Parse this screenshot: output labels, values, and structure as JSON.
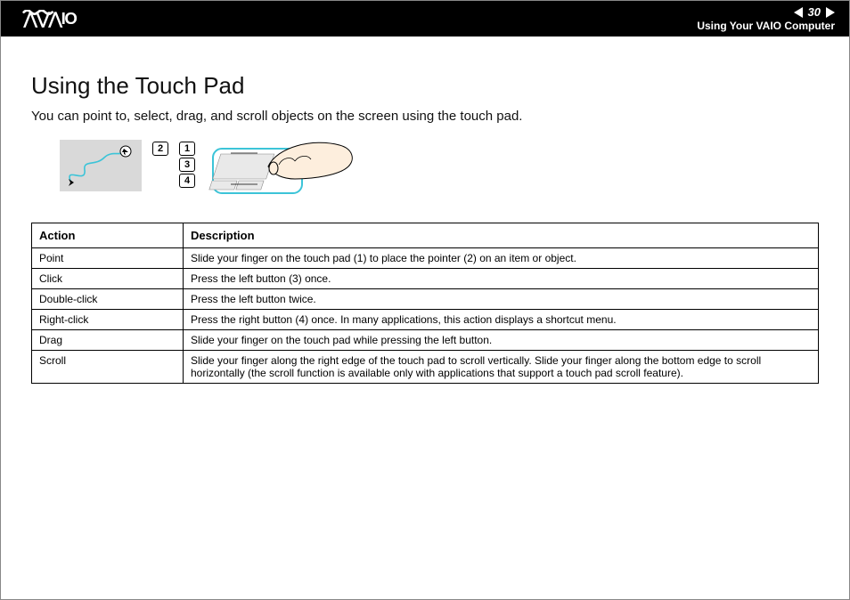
{
  "header": {
    "page_number": "30",
    "section": "Using Your VAIO Computer"
  },
  "body": {
    "title": "Using the Touch Pad",
    "intro": "You can point to, select, drag, and scroll objects on the screen using the touch pad."
  },
  "labels": {
    "n1": "1",
    "n2": "2",
    "n3": "3",
    "n4": "4"
  },
  "table": {
    "head_action": "Action",
    "head_desc": "Description",
    "rows": [
      {
        "action": "Point",
        "desc": "Slide your finger on the touch pad (1) to place the pointer (2) on an item or object."
      },
      {
        "action": "Click",
        "desc": "Press the left button (3) once."
      },
      {
        "action": "Double-click",
        "desc": "Press the left button twice."
      },
      {
        "action": "Right-click",
        "desc": "Press the right button (4) once. In many applications, this action displays a shortcut menu."
      },
      {
        "action": "Drag",
        "desc": "Slide your finger on the touch pad while pressing the left button."
      },
      {
        "action": "Scroll",
        "desc": "Slide your finger along the right edge of the touch pad to scroll vertically. Slide your finger along the bottom edge to scroll horizontally (the scroll function is available only with applications that support a touch pad scroll feature)."
      }
    ]
  }
}
